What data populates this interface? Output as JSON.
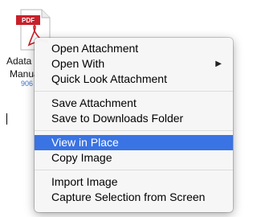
{
  "attachment": {
    "badge": "PDF",
    "name_line1": "Adata",
    "name_line2": "Manua",
    "size": "906"
  },
  "context_menu": {
    "groups": [
      [
        {
          "label": "Open Attachment"
        },
        {
          "label": "Open With",
          "submenu": true
        },
        {
          "label": "Quick Look Attachment"
        }
      ],
      [
        {
          "label": "Save Attachment"
        },
        {
          "label": "Save to Downloads Folder"
        }
      ],
      [
        {
          "label": "View in Place",
          "highlighted": true
        },
        {
          "label": "Copy Image"
        }
      ],
      [
        {
          "label": "Import Image"
        },
        {
          "label": "Capture Selection from Screen"
        }
      ]
    ],
    "submenu_arrow": "▶"
  },
  "colors": {
    "highlight": "#3a73e3",
    "pdf_red": "#c8202a",
    "link_blue": "#3d73c8"
  }
}
